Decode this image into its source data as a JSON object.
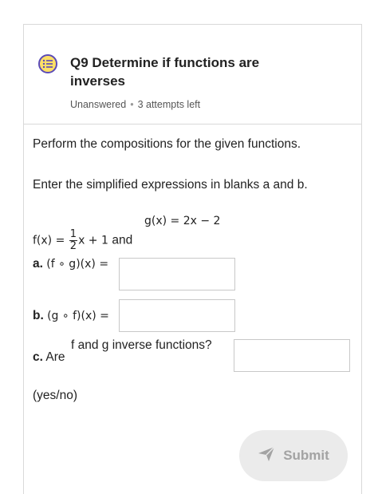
{
  "question": {
    "title": "Q9 Determine if functions are inverses",
    "status": "Unanswered",
    "attempts": "3 attempts left",
    "icon": "question-list-icon"
  },
  "instructions": {
    "line1": "Perform the compositions for the given functions.",
    "line2": "Enter the simplified expressions in blanks a and b."
  },
  "functions": {
    "f_prefix": "f(x) =",
    "f_num": "1",
    "f_den": "2",
    "f_suffix": "x + 1",
    "and": "and",
    "g": "g(x) = 2x − 2"
  },
  "parts": {
    "a_label": "a.",
    "a_expr": "(f ∘ g)(x) =",
    "a_value": "",
    "b_label": "b.",
    "b_expr": "(g ∘ f)(x) =",
    "b_value": "",
    "c_label": "c.",
    "c_are": "Are",
    "c_question": "f and g inverse functions?",
    "c_value": "",
    "yes_no": "(yes/no)"
  },
  "submit": {
    "label": "Submit",
    "icon": "send-icon"
  }
}
